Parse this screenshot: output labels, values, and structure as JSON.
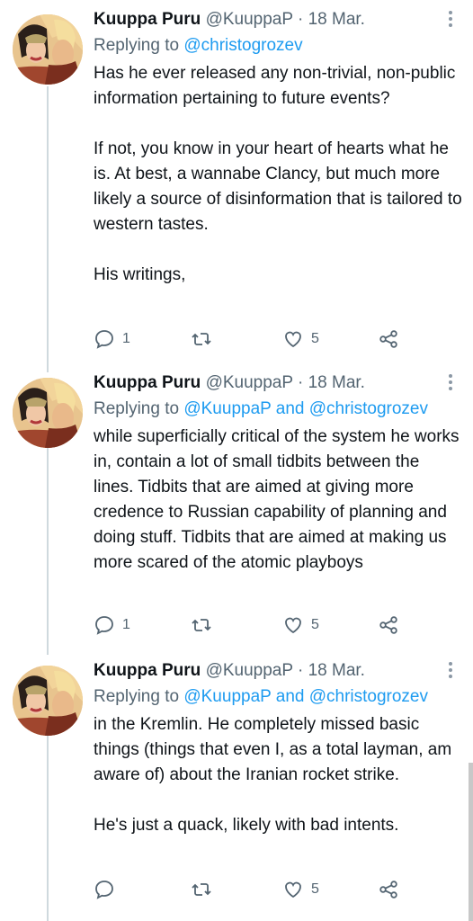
{
  "tweets": [
    {
      "name": "Kuuppa Puru",
      "handle": "@KuuppaP",
      "separator": "·",
      "date": "18 Mar.",
      "replying_prefix": "Replying to",
      "replying_to": "@christogrozev",
      "paragraphs": [
        "Has he ever released any non-trivial, non-public information pertaining to future events?",
        "If not, you know in your heart of hearts what he is. At best, a wannabe Clancy, but much more likely a source of disinformation that is tailored to western tastes.",
        "His writings,"
      ],
      "replies": "1",
      "retweets": "",
      "likes": "5"
    },
    {
      "name": "Kuuppa Puru",
      "handle": "@KuuppaP",
      "separator": "·",
      "date": "18 Mar.",
      "replying_prefix": "Replying to",
      "replying_to": "@KuuppaP and @christogrozev",
      "paragraphs": [
        "while superficially critical of the system he works in, contain a lot of small tidbits between the lines. Tidbits that are aimed at giving more credence to Russian capability of planning and doing stuff. Tidbits that are aimed at making us more scared of the atomic playboys"
      ],
      "replies": "1",
      "retweets": "",
      "likes": "5"
    },
    {
      "name": "Kuuppa Puru",
      "handle": "@KuuppaP",
      "separator": "·",
      "date": "18 Mar.",
      "replying_prefix": "Replying to",
      "replying_to": "@KuuppaP and @christogrozev",
      "paragraphs": [
        "in the Kremlin. He completely missed basic things (things that even I, as a total layman, am aware of) about the Iranian rocket strike.",
        "He's just a quack, likely with bad intents."
      ],
      "replies": "",
      "retweets": "",
      "likes": "5"
    }
  ],
  "colors": {
    "link": "#1d9bf0",
    "secondary_text": "#536471",
    "thread_line": "#cfd9de"
  },
  "icons": [
    "reply-icon",
    "retweet-icon",
    "like-icon",
    "share-icon",
    "more-icon"
  ]
}
